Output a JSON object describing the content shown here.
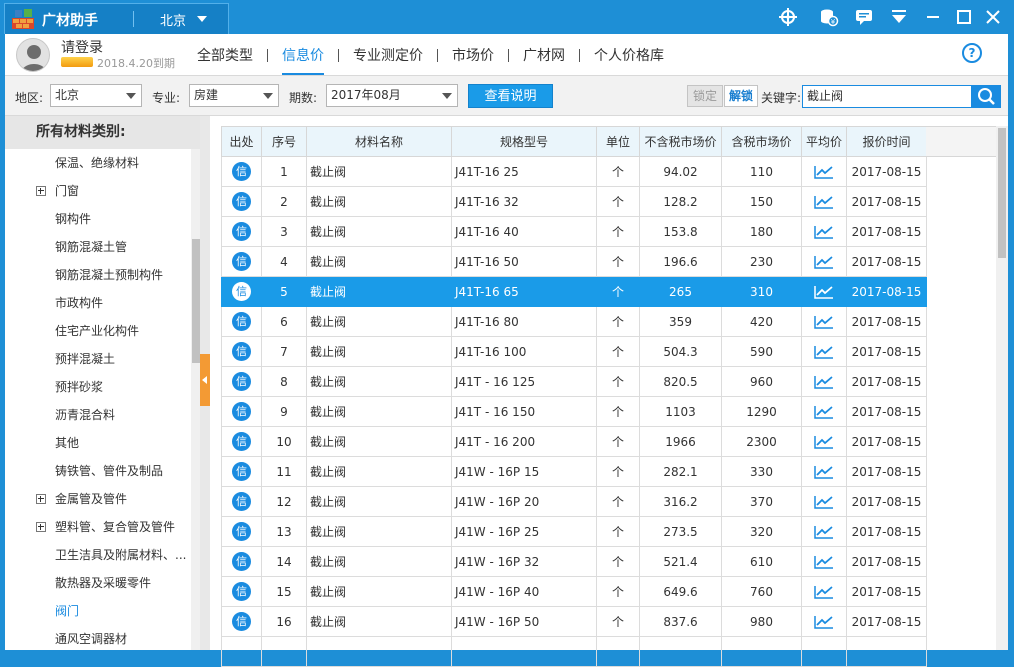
{
  "titlebar": {
    "app_title": "广材助手",
    "city": "北京",
    "icons": [
      "target-icon",
      "coins-icon",
      "message-icon",
      "download-icon",
      "minimize-icon",
      "maximize-icon",
      "close-icon"
    ]
  },
  "user": {
    "login_text": "请登录",
    "expire_text": "2018.4.20到期"
  },
  "nav": {
    "items": [
      {
        "label": "全部类型"
      },
      {
        "label": "信息价",
        "active": true
      },
      {
        "label": "专业测定价"
      },
      {
        "label": "市场价"
      },
      {
        "label": "广材网"
      },
      {
        "label": "个人价格库"
      }
    ],
    "help": "?"
  },
  "filters": {
    "region_label": "地区:",
    "region_value": "北京",
    "specialty_label": "专业:",
    "specialty_value": "房建",
    "period_label": "期数:",
    "period_value": "2017年08月",
    "explain_button": "查看说明",
    "lock_button": "锁定",
    "unlock_button": "解锁",
    "keyword_label": "关键字:",
    "keyword_value": "截止阀"
  },
  "sidebar": {
    "title": "所有材料类别:",
    "items": [
      {
        "label": "保温、绝缘材料",
        "expandable": false
      },
      {
        "label": "门窗",
        "expandable": true
      },
      {
        "label": "钢构件",
        "expandable": false
      },
      {
        "label": "钢筋混凝土管",
        "expandable": false
      },
      {
        "label": "钢筋混凝土预制构件",
        "expandable": false
      },
      {
        "label": "市政构件",
        "expandable": false
      },
      {
        "label": "住宅产业化构件",
        "expandable": false
      },
      {
        "label": "预拌混凝土",
        "expandable": false
      },
      {
        "label": "预拌砂浆",
        "expandable": false
      },
      {
        "label": "沥青混合料",
        "expandable": false
      },
      {
        "label": "其他",
        "expandable": false
      },
      {
        "label": "铸铁管、管件及制品",
        "expandable": false
      },
      {
        "label": "金属管及管件",
        "expandable": true
      },
      {
        "label": "塑料管、复合管及管件",
        "expandable": true
      },
      {
        "label": "卫生洁具及附属材料、...",
        "expandable": false
      },
      {
        "label": "散热器及采暖零件",
        "expandable": false
      },
      {
        "label": "阀门",
        "expandable": false,
        "selected": true
      },
      {
        "label": "通风空调器材",
        "expandable": false
      }
    ]
  },
  "table": {
    "headers": [
      "出处",
      "序号",
      "材料名称",
      "规格型号",
      "单位",
      "不含税市场价",
      "含税市场价",
      "平均价",
      "报价时间"
    ],
    "source_badge": "信",
    "highlight_color": "#1a9be8",
    "rows": [
      {
        "no": "1",
        "name": "截止阀",
        "spec": "J41T-16 25",
        "unit": "个",
        "price_ex": "94.02",
        "price_in": "110",
        "date": "2017-08-15"
      },
      {
        "no": "2",
        "name": "截止阀",
        "spec": "J41T-16 32",
        "unit": "个",
        "price_ex": "128.2",
        "price_in": "150",
        "date": "2017-08-15"
      },
      {
        "no": "3",
        "name": "截止阀",
        "spec": "J41T-16 40",
        "unit": "个",
        "price_ex": "153.8",
        "price_in": "180",
        "date": "2017-08-15"
      },
      {
        "no": "4",
        "name": "截止阀",
        "spec": "J41T-16 50",
        "unit": "个",
        "price_ex": "196.6",
        "price_in": "230",
        "date": "2017-08-15"
      },
      {
        "no": "5",
        "name": "截止阀",
        "spec": "J41T-16 65",
        "unit": "个",
        "price_ex": "265",
        "price_in": "310",
        "date": "2017-08-15",
        "selected": true
      },
      {
        "no": "6",
        "name": "截止阀",
        "spec": "J41T-16 80",
        "unit": "个",
        "price_ex": "359",
        "price_in": "420",
        "date": "2017-08-15"
      },
      {
        "no": "7",
        "name": "截止阀",
        "spec": "J41T-16 100",
        "unit": "个",
        "price_ex": "504.3",
        "price_in": "590",
        "date": "2017-08-15"
      },
      {
        "no": "8",
        "name": "截止阀",
        "spec": "J41T - 16 125",
        "unit": "个",
        "price_ex": "820.5",
        "price_in": "960",
        "date": "2017-08-15"
      },
      {
        "no": "9",
        "name": "截止阀",
        "spec": "J41T - 16 150",
        "unit": "个",
        "price_ex": "1103",
        "price_in": "1290",
        "date": "2017-08-15"
      },
      {
        "no": "10",
        "name": "截止阀",
        "spec": "J41T - 16 200",
        "unit": "个",
        "price_ex": "1966",
        "price_in": "2300",
        "date": "2017-08-15"
      },
      {
        "no": "11",
        "name": "截止阀",
        "spec": "J41W - 16P 15",
        "unit": "个",
        "price_ex": "282.1",
        "price_in": "330",
        "date": "2017-08-15"
      },
      {
        "no": "12",
        "name": "截止阀",
        "spec": "J41W - 16P 20",
        "unit": "个",
        "price_ex": "316.2",
        "price_in": "370",
        "date": "2017-08-15"
      },
      {
        "no": "13",
        "name": "截止阀",
        "spec": "J41W - 16P 25",
        "unit": "个",
        "price_ex": "273.5",
        "price_in": "320",
        "date": "2017-08-15"
      },
      {
        "no": "14",
        "name": "截止阀",
        "spec": "J41W - 16P 32",
        "unit": "个",
        "price_ex": "521.4",
        "price_in": "610",
        "date": "2017-08-15"
      },
      {
        "no": "15",
        "name": "截止阀",
        "spec": "J41W - 16P 40",
        "unit": "个",
        "price_ex": "649.6",
        "price_in": "760",
        "date": "2017-08-15"
      },
      {
        "no": "16",
        "name": "截止阀",
        "spec": "J41W - 16P 50",
        "unit": "个",
        "price_ex": "837.6",
        "price_in": "980",
        "date": "2017-08-15"
      },
      {
        "no": "",
        "name": "",
        "spec": "",
        "unit": "",
        "price_ex": "",
        "price_in": "",
        "date": ""
      }
    ]
  }
}
